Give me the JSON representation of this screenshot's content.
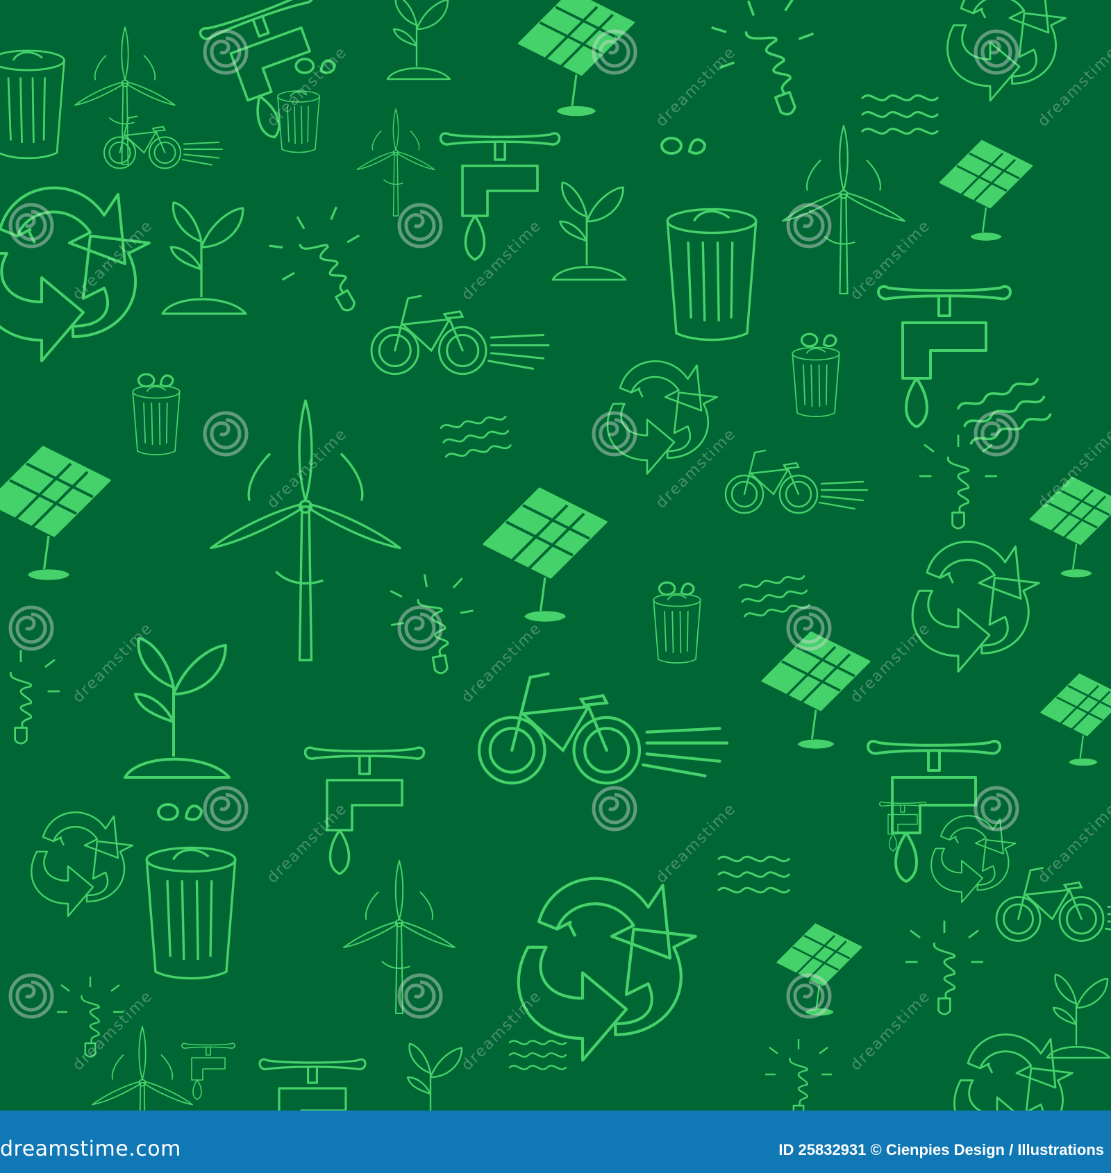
{
  "image": {
    "background_color": "#006633",
    "icon_color": "#46d26a",
    "icon_light_color": "#5fe07f",
    "icons": [
      "wind-turbine-icon",
      "bicycle-icon",
      "recycle-icon",
      "trash-can-icon",
      "solar-panel-icon",
      "faucet-icon",
      "sprout-icon",
      "light-bulb-icon",
      "wave-icon"
    ]
  },
  "footer": {
    "background_color": "#1178b6",
    "site": "dreamstime.com",
    "credit": "ID 25832931 © Cienpies Design / Illustrations"
  },
  "watermark": {
    "text": "dreamstime"
  }
}
